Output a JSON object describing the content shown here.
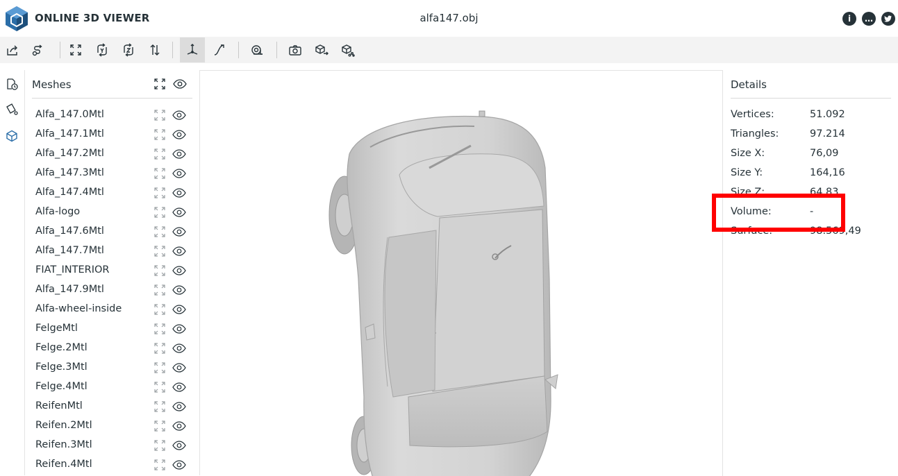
{
  "header": {
    "app_title": "ONLINE 3D VIEWER",
    "file_name": "alfa147.obj",
    "icons": [
      "info-icon",
      "message-icon",
      "twitter-icon"
    ]
  },
  "toolbar": {
    "buttons": [
      {
        "name": "open-file-button",
        "icon": "open-file-icon"
      },
      {
        "name": "open-url-button",
        "icon": "open-url-icon"
      },
      {
        "name": "fit-to-window-button",
        "icon": "fit-icon"
      },
      {
        "name": "set-up-y-button",
        "icon": "up-y-icon"
      },
      {
        "name": "set-up-z-button",
        "icon": "up-z-icon"
      },
      {
        "name": "flip-up-button",
        "icon": "flip-icon"
      },
      {
        "name": "fixed-up-vector-button",
        "icon": "fixed-up-icon",
        "selected": true
      },
      {
        "name": "free-orbit-button",
        "icon": "free-orbit-icon"
      },
      {
        "name": "measure-button",
        "icon": "measure-icon"
      },
      {
        "name": "export-snapshot-button",
        "icon": "camera-icon"
      },
      {
        "name": "export-model-button",
        "icon": "export-icon"
      },
      {
        "name": "share-model-button",
        "icon": "share-icon"
      }
    ]
  },
  "left_nav": [
    "file-info-icon",
    "materials-icon",
    "meshes-icon"
  ],
  "meshes_panel": {
    "title": "Meshes",
    "items": [
      "Alfa_147.0Mtl",
      "Alfa_147.1Mtl",
      "Alfa_147.2Mtl",
      "Alfa_147.3Mtl",
      "Alfa_147.4Mtl",
      "Alfa-logo",
      "Alfa_147.6Mtl",
      "Alfa_147.7Mtl",
      "FIAT_INTERIOR",
      "Alfa_147.9Mtl",
      "Alfa-wheel-inside",
      "FelgeMtl",
      "Felge.2Mtl",
      "Felge.3Mtl",
      "Felge.4Mtl",
      "ReifenMtl",
      "Reifen.2Mtl",
      "Reifen.3Mtl",
      "Reifen.4Mtl"
    ]
  },
  "details_panel": {
    "title": "Details",
    "properties": [
      {
        "name": "Vertices:",
        "value": "51.092"
      },
      {
        "name": "Triangles:",
        "value": "97.214"
      },
      {
        "name": "Size X:",
        "value": "76,09"
      },
      {
        "name": "Size Y:",
        "value": "164,16"
      },
      {
        "name": "Size Z:",
        "value": "64,83"
      },
      {
        "name": "Volume:",
        "value": "-"
      },
      {
        "name": "Surface:",
        "value": "98.569,49"
      }
    ]
  },
  "colors": {
    "highlight": "#ff0000",
    "toolbar_bg": "#f3f3f3",
    "text": "#263238",
    "model": "#d6d6d6"
  }
}
